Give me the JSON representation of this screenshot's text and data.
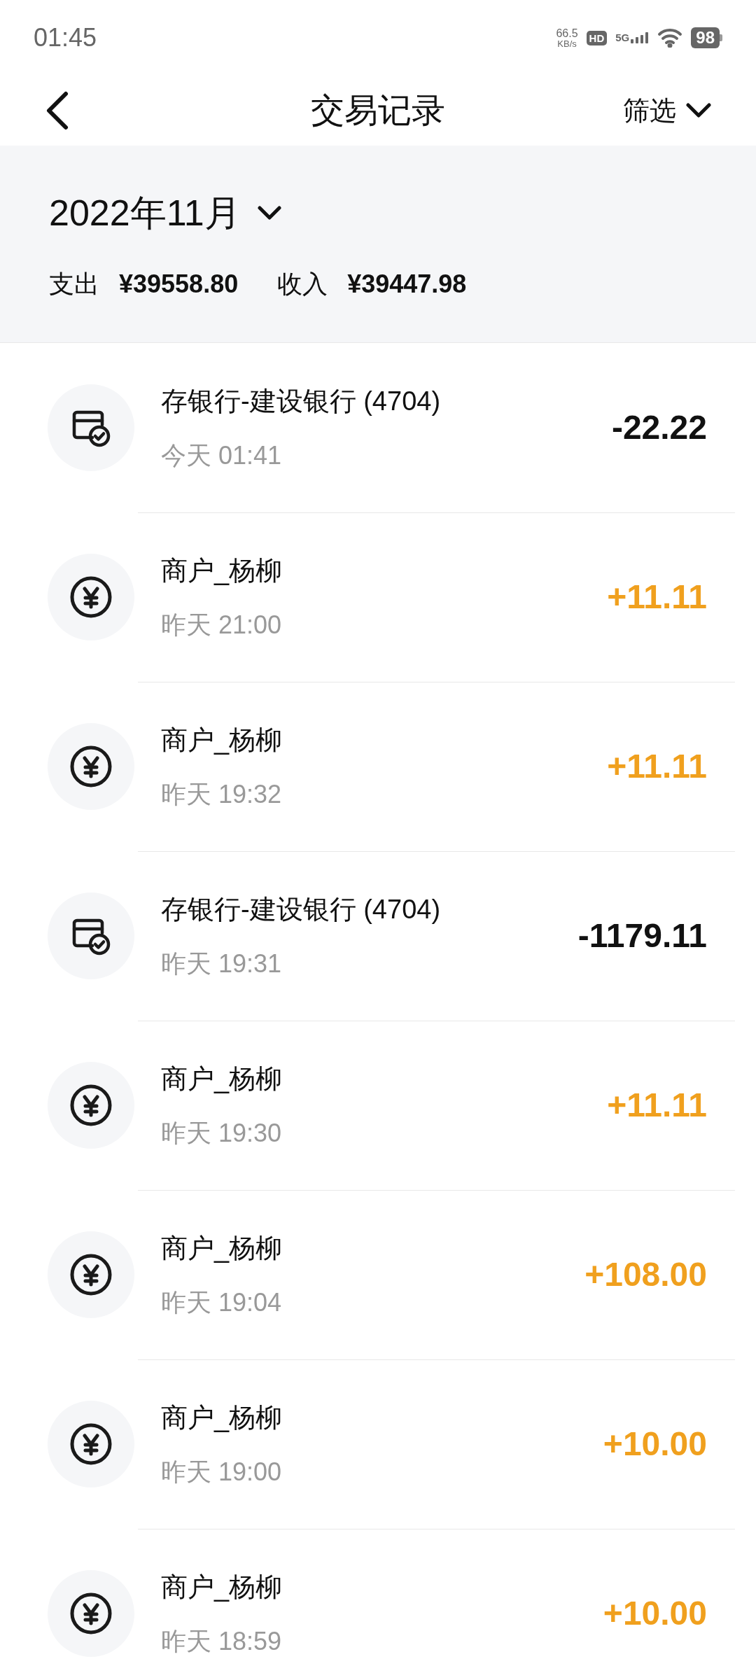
{
  "status_bar": {
    "time": "01:45",
    "speed": "66.5",
    "speed_unit": "KB/s",
    "hd": "HD",
    "network": "5G",
    "battery": "98"
  },
  "header": {
    "title": "交易记录",
    "filter": "筛选"
  },
  "summary": {
    "month": "2022年11月",
    "expense_label": "支出",
    "expense": "¥39558.80",
    "income_label": "收入",
    "income": "¥39447.98"
  },
  "transactions": [
    {
      "kind": "bank",
      "title": "存银行-建设银行 (4704)",
      "time": "今天 01:41",
      "amount": "-22.22",
      "color": "#111111"
    },
    {
      "kind": "merchant",
      "title": "商户_杨柳",
      "time": "昨天 21:00",
      "amount": "+11.11",
      "color": "#f0a01e"
    },
    {
      "kind": "merchant",
      "title": "商户_杨柳",
      "time": "昨天 19:32",
      "amount": "+11.11",
      "color": "#f0a01e"
    },
    {
      "kind": "bank",
      "title": "存银行-建设银行 (4704)",
      "time": "昨天 19:31",
      "amount": "-1179.11",
      "color": "#111111"
    },
    {
      "kind": "merchant",
      "title": "商户_杨柳",
      "time": "昨天 19:30",
      "amount": "+11.11",
      "color": "#f0a01e"
    },
    {
      "kind": "merchant",
      "title": "商户_杨柳",
      "time": "昨天 19:04",
      "amount": "+108.00",
      "color": "#f0a01e"
    },
    {
      "kind": "merchant",
      "title": "商户_杨柳",
      "time": "昨天 19:00",
      "amount": "+10.00",
      "color": "#f0a01e"
    },
    {
      "kind": "merchant",
      "title": "商户_杨柳",
      "time": "昨天 18:59",
      "amount": "+10.00",
      "color": "#f0a01e"
    }
  ]
}
